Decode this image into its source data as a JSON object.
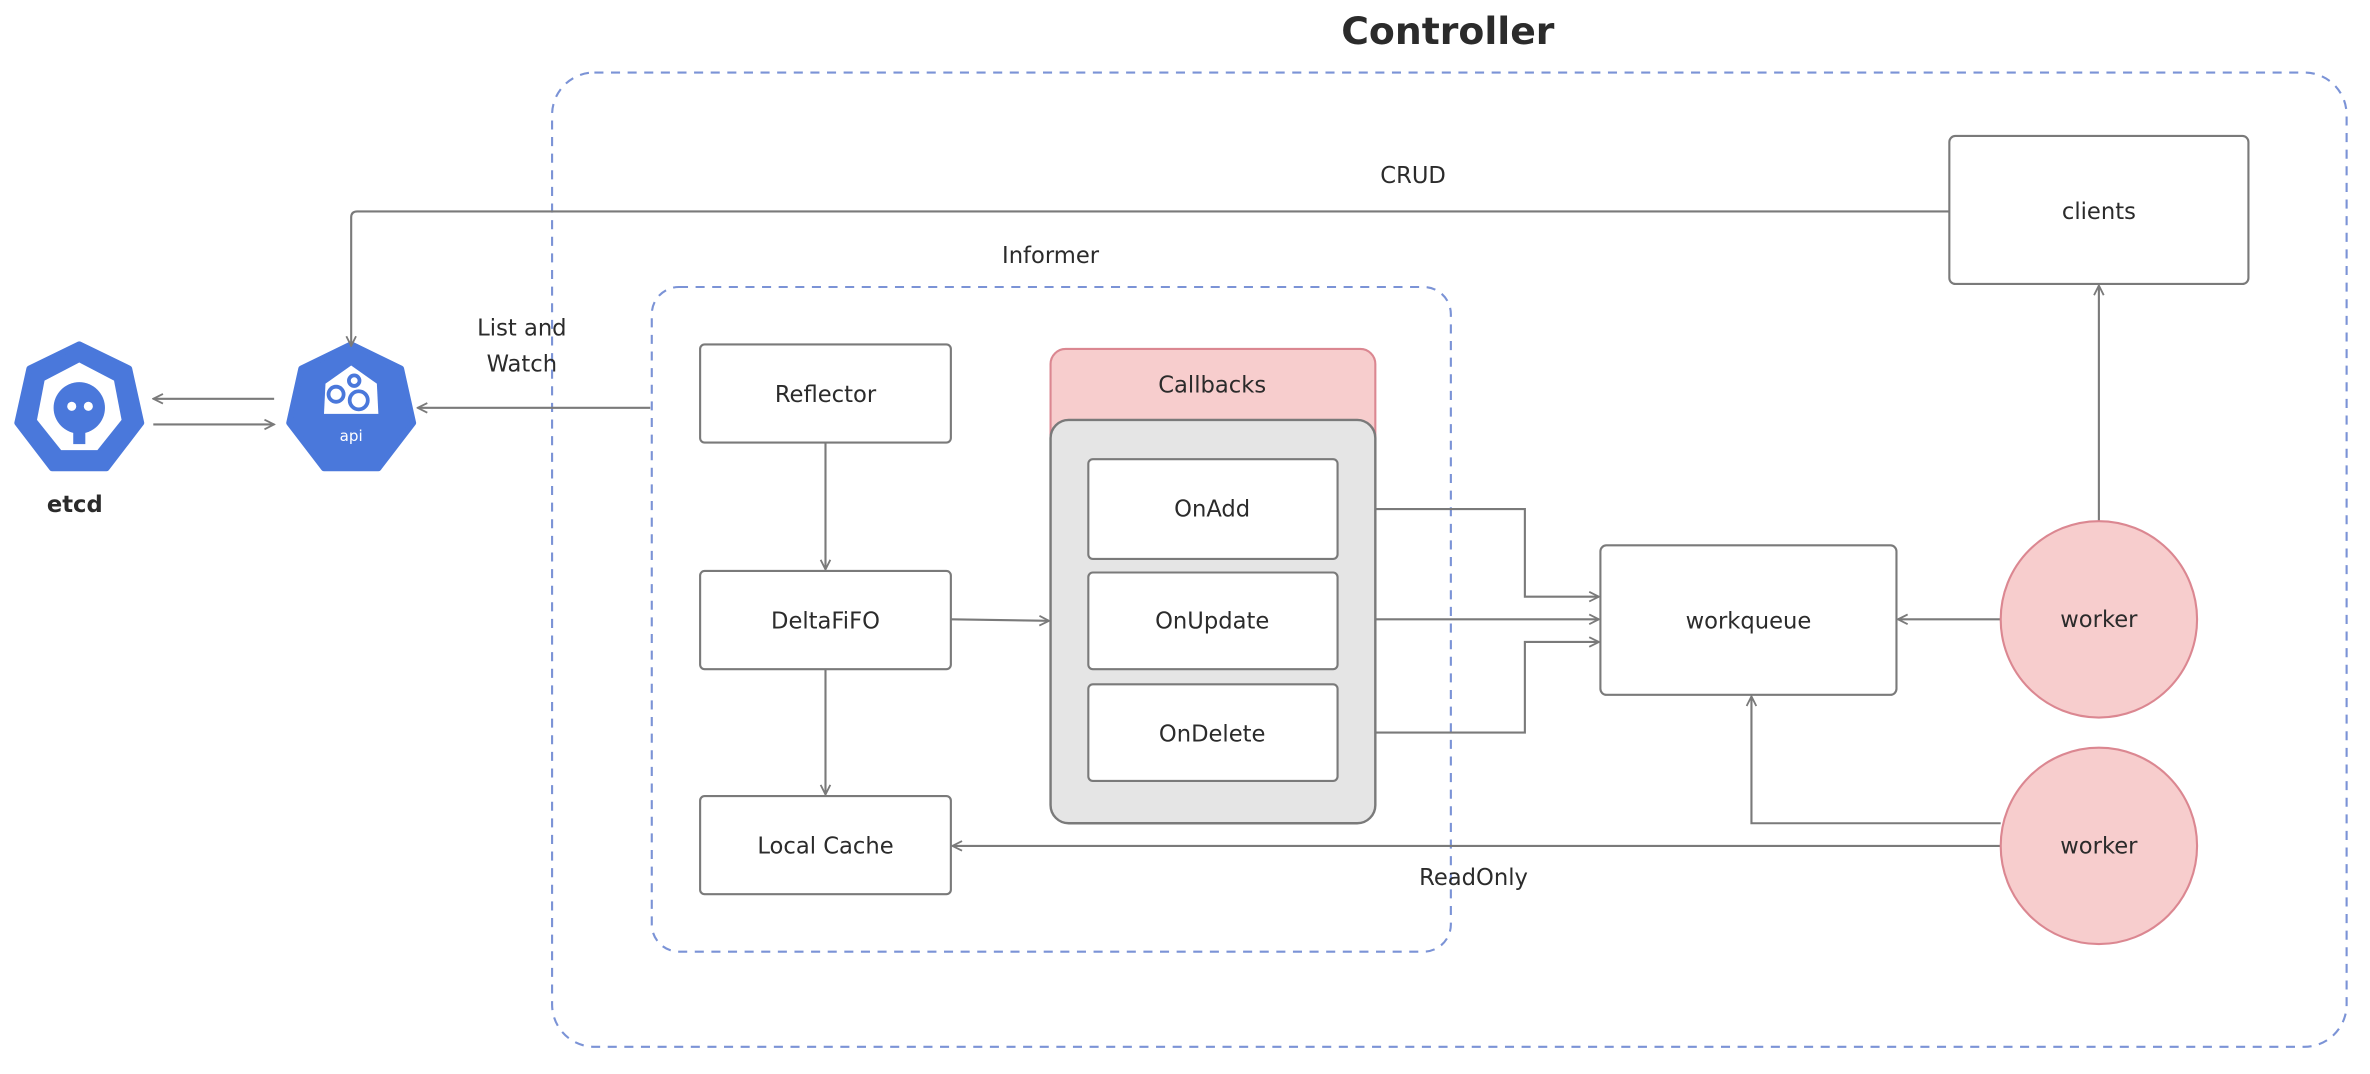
{
  "title": "Controller",
  "informer_label": "Informer",
  "nodes": {
    "etcd": "etcd",
    "api": "api",
    "reflector": "Reflector",
    "deltafifo": "DeltaFiFO",
    "local_cache": "Local Cache",
    "callbacks": "Callbacks",
    "on_add": "OnAdd",
    "on_update": "OnUpdate",
    "on_delete": "OnDelete",
    "workqueue": "workqueue",
    "clients": "clients",
    "worker1": "worker",
    "worker2": "worker"
  },
  "edges": {
    "crud": "CRUD",
    "list_watch_1": "List and",
    "list_watch_2": "Watch",
    "readonly": "ReadOnly"
  },
  "colors": {
    "k8s_blue": "#326CE5",
    "dashed_border": "#7B93D6",
    "pink_fill": "#F7CDCD",
    "pink_stroke": "#DB8791",
    "gray_fill": "#E5E5E5"
  }
}
